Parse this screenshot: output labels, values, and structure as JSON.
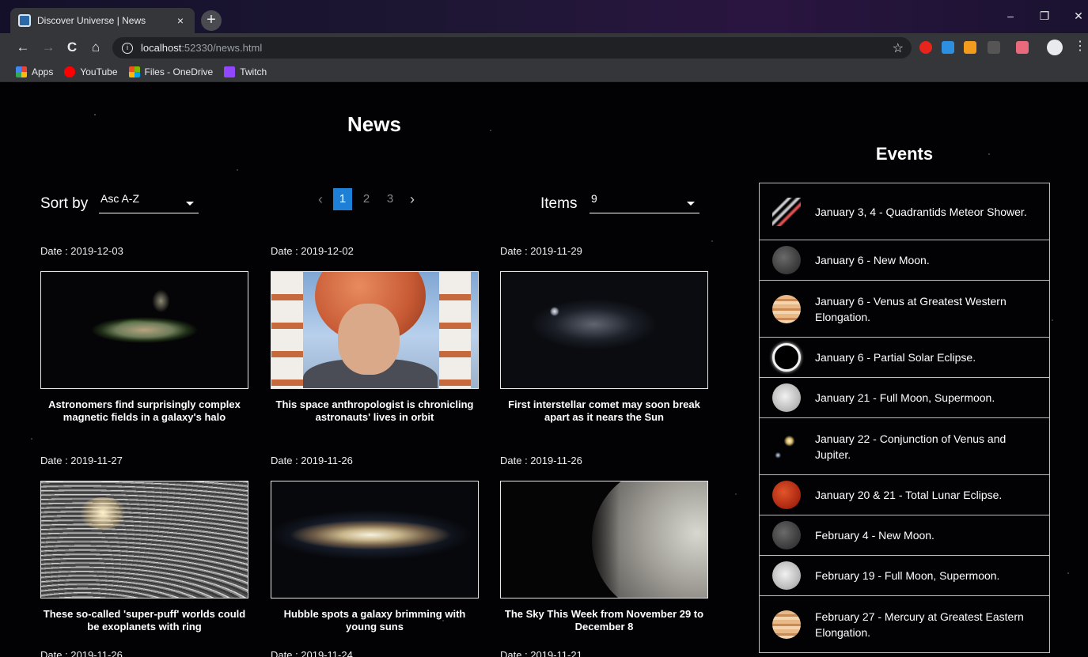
{
  "browser": {
    "tab_title": "Discover Universe | News",
    "tab_close": "×",
    "new_tab": "+",
    "url_host": "localhost",
    "url_rest": ":52330/news.html",
    "controls": {
      "minimize": "–",
      "restore": "❐",
      "close": "✕"
    },
    "nav": {
      "back": "←",
      "forward": "→",
      "reload": "C",
      "home": "⌂"
    },
    "star": "☆",
    "menu": "⋮",
    "bookmarks": [
      {
        "label": "Apps",
        "icon": "apps-grid-icon",
        "color": "#e3a21a"
      },
      {
        "label": "YouTube",
        "icon": "youtube-icon",
        "color": "#ff0000"
      },
      {
        "label": "Files - OneDrive",
        "icon": "microsoft-icon",
        "color": "#7fba00"
      },
      {
        "label": "Twitch",
        "icon": "twitch-icon",
        "color": "#9146ff"
      }
    ]
  },
  "page": {
    "title": "News",
    "sort": {
      "label": "Sort by",
      "value": "Asc A-Z"
    },
    "pagination": {
      "prev": "‹",
      "next": "›",
      "pages": [
        "1",
        "2",
        "3"
      ],
      "active": "1"
    },
    "items": {
      "label": "Items",
      "value": "9"
    },
    "news": [
      {
        "date": "Date : 2019-12-03",
        "title": "Astronomers find surprisingly complex magnetic fields in a galaxy's halo"
      },
      {
        "date": "Date : 2019-12-02",
        "title": "This space anthropologist is chronicling astronauts' lives in orbit"
      },
      {
        "date": "Date : 2019-11-29",
        "title": "First interstellar comet may soon break apart as it nears the Sun"
      },
      {
        "date": "Date : 2019-11-27",
        "title": "These so-called 'super-puff' worlds could be exoplanets with ring"
      },
      {
        "date": "Date : 2019-11-26",
        "title": "Hubble spots a galaxy brimming with young suns"
      },
      {
        "date": "Date : 2019-11-26",
        "title": "The Sky This Week from November 29 to December 8"
      },
      {
        "date": "Date : 2019-11-26",
        "title": ""
      },
      {
        "date": "Date : 2019-11-24",
        "title": ""
      },
      {
        "date": "Date : 2019-11-21",
        "title": ""
      }
    ]
  },
  "events": {
    "title": "Events",
    "items": [
      {
        "text": "January 3, 4 - Quadrantids Meteor Shower.",
        "icon": "meteor-shower-icon"
      },
      {
        "text": "January 6 - New Moon.",
        "icon": "new-moon-icon"
      },
      {
        "text": "January 6 - Venus at Greatest Western Elongation.",
        "icon": "planet-icon"
      },
      {
        "text": "January 6 - Partial Solar Eclipse.",
        "icon": "solar-eclipse-icon"
      },
      {
        "text": "January 21 - Full Moon, Supermoon.",
        "icon": "full-moon-icon"
      },
      {
        "text": "January 22 - Conjunction of Venus and Jupiter.",
        "icon": "conjunction-icon"
      },
      {
        "text": "January 20 & 21 - Total Lunar Eclipse.",
        "icon": "lunar-eclipse-icon"
      },
      {
        "text": "February 4 - New Moon.",
        "icon": "new-moon-icon"
      },
      {
        "text": "February 19 - Full Moon, Supermoon.",
        "icon": "full-moon-icon"
      },
      {
        "text": "February 27 - Mercury at Greatest Eastern Elongation.",
        "icon": "planet-icon"
      }
    ]
  }
}
